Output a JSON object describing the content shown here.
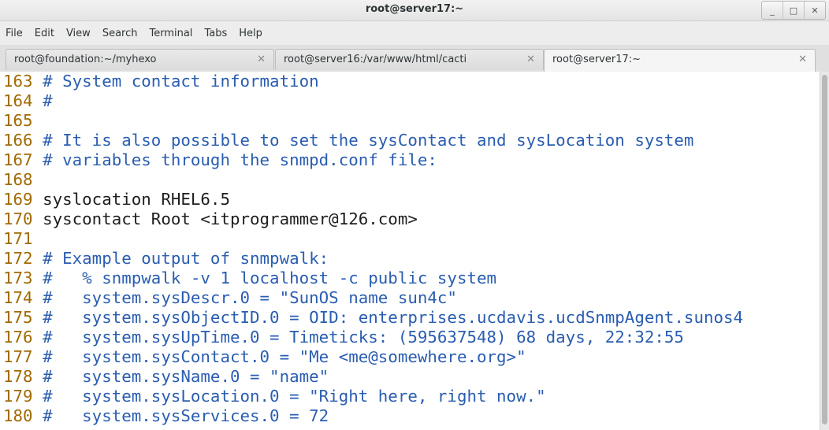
{
  "window": {
    "title": "root@server17:~",
    "controls": [
      "minimize-icon",
      "maximize-icon",
      "close-icon"
    ],
    "minimize_glyph": "_",
    "maximize_glyph": "□",
    "close_glyph": "✕"
  },
  "menu": [
    "File",
    "Edit",
    "View",
    "Search",
    "Terminal",
    "Tabs",
    "Help"
  ],
  "tabs": [
    {
      "label": "root@foundation:~/myhexo",
      "close": "✕"
    },
    {
      "label": "root@server16:/var/www/html/cacti",
      "close": "✕"
    },
    {
      "label": "root@server17:~",
      "close": "✕"
    }
  ],
  "colors": {
    "line_number": "#a16a00",
    "comment": "#2a5db0",
    "text": "#1e1e1e"
  },
  "lines": [
    {
      "num": "163",
      "text": " # System contact information",
      "kind": "comment"
    },
    {
      "num": "164",
      "text": " #",
      "kind": "comment"
    },
    {
      "num": "165",
      "text": "",
      "kind": "text"
    },
    {
      "num": "166",
      "text": " # It is also possible to set the sysContact and sysLocation system",
      "kind": "comment"
    },
    {
      "num": "167",
      "text": " # variables through the snmpd.conf file:",
      "kind": "comment"
    },
    {
      "num": "168",
      "text": "",
      "kind": "text"
    },
    {
      "num": "169",
      "text": " syslocation RHEL6.5",
      "kind": "text"
    },
    {
      "num": "170",
      "text": " syscontact Root <itprogrammer@126.com>",
      "kind": "text"
    },
    {
      "num": "171",
      "text": "",
      "kind": "text"
    },
    {
      "num": "172",
      "text": " # Example output of snmpwalk:",
      "kind": "comment"
    },
    {
      "num": "173",
      "text": " #   % snmpwalk -v 1 localhost -c public system",
      "kind": "comment"
    },
    {
      "num": "174",
      "text": " #   system.sysDescr.0 = \"SunOS name sun4c\"",
      "kind": "comment"
    },
    {
      "num": "175",
      "text": " #   system.sysObjectID.0 = OID: enterprises.ucdavis.ucdSnmpAgent.sunos4",
      "kind": "comment"
    },
    {
      "num": "176",
      "text": " #   system.sysUpTime.0 = Timeticks: (595637548) 68 days, 22:32:55",
      "kind": "comment"
    },
    {
      "num": "177",
      "text": " #   system.sysContact.0 = \"Me <me@somewhere.org>\"",
      "kind": "comment"
    },
    {
      "num": "178",
      "text": " #   system.sysName.0 = \"name\"",
      "kind": "comment"
    },
    {
      "num": "179",
      "text": " #   system.sysLocation.0 = \"Right here, right now.\"",
      "kind": "comment"
    },
    {
      "num": "180",
      "text": " #   system.sysServices.0 = 72",
      "kind": "comment"
    }
  ]
}
